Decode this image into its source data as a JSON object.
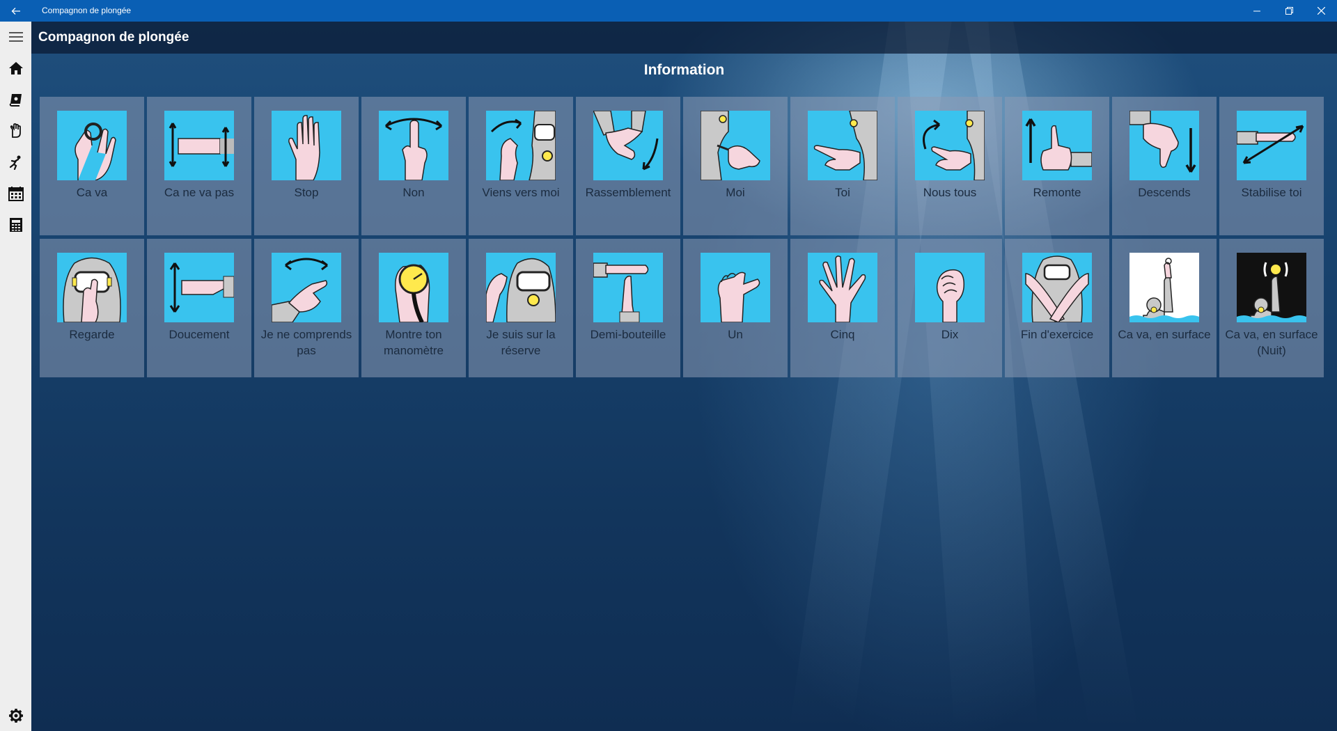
{
  "window": {
    "title": "Compagnon de plongée"
  },
  "app": {
    "title": "Compagnon de plongée",
    "section_title": "Information"
  },
  "rail": {
    "items": [
      {
        "icon": "hamburger-menu-icon"
      },
      {
        "icon": "home-icon"
      },
      {
        "icon": "logbook-icon"
      },
      {
        "icon": "hand-sign-icon"
      },
      {
        "icon": "diver-icon"
      },
      {
        "icon": "calendar-icon"
      },
      {
        "icon": "calculator-icon"
      },
      {
        "icon": "settings-gear-icon"
      }
    ]
  },
  "signs": [
    {
      "label": "Ca va",
      "icon": "ok-hand-sign"
    },
    {
      "label": "Ca ne va pas",
      "icon": "not-ok-hand-sign"
    },
    {
      "label": "Stop",
      "icon": "stop-hand-sign"
    },
    {
      "label": "Non",
      "icon": "no-finger-sign"
    },
    {
      "label": "Viens vers moi",
      "icon": "come-to-me-sign"
    },
    {
      "label": "Rassemblement",
      "icon": "regroup-sign"
    },
    {
      "label": "Moi",
      "icon": "me-sign"
    },
    {
      "label": "Toi",
      "icon": "you-sign"
    },
    {
      "label": "Nous tous",
      "icon": "all-of-us-sign"
    },
    {
      "label": "Remonte",
      "icon": "go-up-sign"
    },
    {
      "label": "Descends",
      "icon": "go-down-sign"
    },
    {
      "label": "Stabilise toi",
      "icon": "stabilize-sign"
    },
    {
      "label": "Regarde",
      "icon": "look-sign"
    },
    {
      "label": "Doucement",
      "icon": "slowly-sign"
    },
    {
      "label": "Je ne comprends pas",
      "icon": "dont-understand-sign"
    },
    {
      "label": "Montre ton manomètre",
      "icon": "show-gauge-sign"
    },
    {
      "label": "Je suis sur la réserve",
      "icon": "on-reserve-sign"
    },
    {
      "label": "Demi-bouteille",
      "icon": "half-tank-sign"
    },
    {
      "label": "Un",
      "icon": "one-sign"
    },
    {
      "label": "Cinq",
      "icon": "five-sign"
    },
    {
      "label": "Dix",
      "icon": "ten-sign"
    },
    {
      "label": "Fin d'exercice",
      "icon": "end-exercise-sign"
    },
    {
      "label": "Ca va, en surface",
      "icon": "ok-surface-sign"
    },
    {
      "label": "Ca va, en surface (Nuit)",
      "icon": "ok-surface-night-sign"
    }
  ],
  "colors": {
    "titlebar": "#0a5fb4",
    "tile_picture_bg": "#39c3ee",
    "tile_bg": "rgba(140,155,180,0.55)"
  }
}
